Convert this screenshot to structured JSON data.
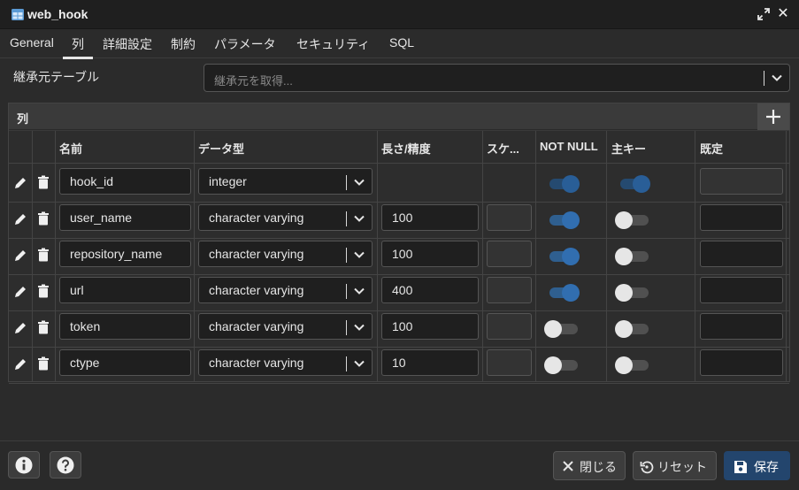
{
  "window": {
    "title": "web_hook",
    "title_icon": "table-icon"
  },
  "tabs": [
    {
      "label": "General"
    },
    {
      "label": "列",
      "active": true
    },
    {
      "label": "詳細設定"
    },
    {
      "label": "制約"
    },
    {
      "label": "パラメータ"
    },
    {
      "label": "セキュリティ"
    },
    {
      "label": "SQL"
    }
  ],
  "inherit": {
    "label": "継承元テーブル",
    "placeholder": "継承元を取得..."
  },
  "columns_panel": {
    "title": "列",
    "headers": {
      "name": "名前",
      "type": "データ型",
      "length": "長さ/精度",
      "scale": "スケ...",
      "not_null": "NOT NULL",
      "primary_key": "主キー",
      "default": "既定"
    },
    "rows": [
      {
        "name": "hook_id",
        "type": "integer",
        "length": "",
        "not_null": true,
        "primary_key": true,
        "length_enabled": false
      },
      {
        "name": "user_name",
        "type": "character varying",
        "length": "100",
        "not_null": true,
        "primary_key": false,
        "length_enabled": true
      },
      {
        "name": "repository_name",
        "type": "character varying",
        "length": "100",
        "not_null": true,
        "primary_key": false,
        "length_enabled": true
      },
      {
        "name": "url",
        "type": "character varying",
        "length": "400",
        "not_null": true,
        "primary_key": false,
        "length_enabled": true
      },
      {
        "name": "token",
        "type": "character varying",
        "length": "100",
        "not_null": false,
        "primary_key": false,
        "length_enabled": true
      },
      {
        "name": "ctype",
        "type": "character varying",
        "length": "10",
        "not_null": false,
        "primary_key": false,
        "length_enabled": true
      }
    ]
  },
  "footer": {
    "close_label": "閉じる",
    "reset_label": "リセット",
    "save_label": "保存"
  },
  "colors": {
    "accent": "#316eb0",
    "primary_button": "#23456d",
    "background": "#2b2b2b"
  }
}
